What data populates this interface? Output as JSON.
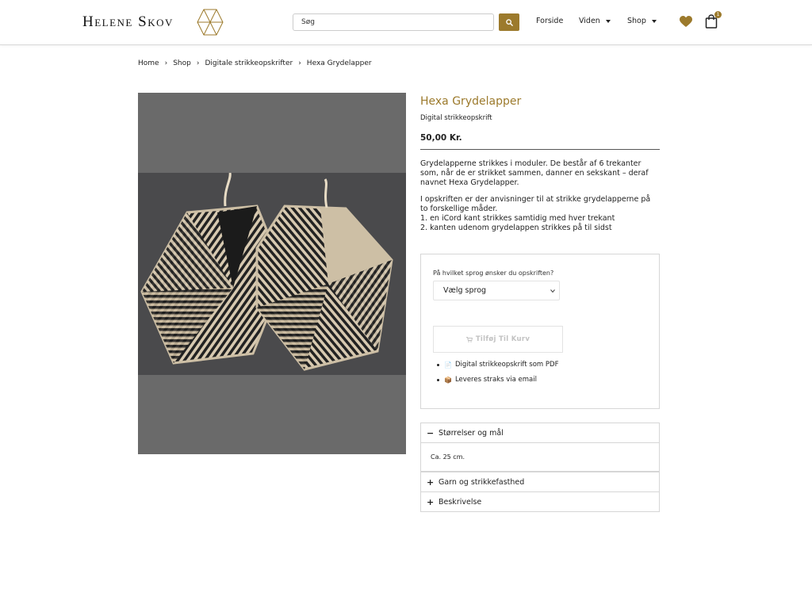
{
  "header": {
    "logo": "Helene Skov",
    "search_placeholder": "Søg",
    "nav": [
      "Forside",
      "Viden",
      "Shop"
    ],
    "cart_count": "1",
    "colors": {
      "accent": "#9c7a2c"
    }
  },
  "breadcrumb": [
    "Home",
    "Shop",
    "Digitale strikkeopskrifter",
    "Hexa Grydelapper"
  ],
  "product": {
    "title": "Hexa Grydelapper",
    "subtitle": "Digital strikkeopskrift",
    "price": "50,00 Kr.",
    "description": [
      "Grydelapperne strikkes i moduler. De består af 6 trekanter som, når de er strikket sammen, danner en sekskant – deraf navnet Hexa Grydelapper.",
      "I opskriften er der anvisninger til at strikke grydelapperne på to forskellige måder."
    ],
    "list": [
      "1. en iCord kant strikkes samtidig med hver trekant",
      "2. kanten udenom grydelappen strikkes på til sidst"
    ]
  },
  "form": {
    "language_label": "På hvilket sprog ønsker du opskriften?",
    "language_selected": "Vælg sprog",
    "add_to_cart": "Tilføj Til Kurv",
    "features": [
      {
        "emoji": "📄",
        "text": "Digital strikkeopskrift som PDF"
      },
      {
        "emoji": "📦",
        "text": "Leveres straks via email"
      }
    ]
  },
  "accordion": [
    {
      "title": "Størrelser og mål",
      "open": true,
      "sign": "−",
      "content": "Ca. 25 cm."
    },
    {
      "title": "Garn og strikkefasthed",
      "open": false,
      "sign": "+"
    },
    {
      "title": "Beskrivelse",
      "open": false,
      "sign": "+"
    }
  ]
}
